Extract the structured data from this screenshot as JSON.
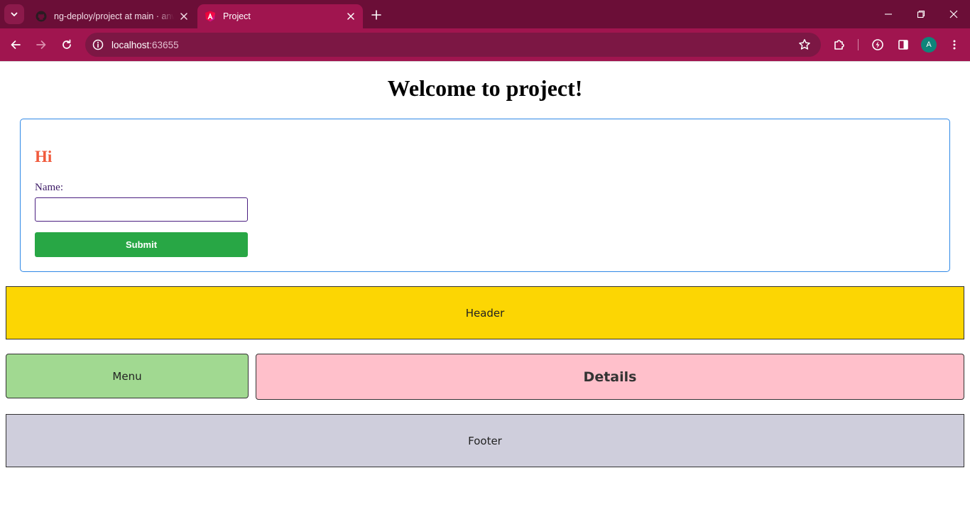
{
  "browser": {
    "tabs": [
      {
        "title": "ng-deploy/project at main · anw",
        "active": false,
        "icon": "github-icon"
      },
      {
        "title": "Project",
        "active": true,
        "icon": "angular-icon"
      }
    ],
    "address": {
      "host": "localhost",
      "port": ":63655"
    },
    "profile_initial": "A"
  },
  "page": {
    "title": "Welcome to project!",
    "form": {
      "greeting": "Hi",
      "name_label": "Name:",
      "name_value": "",
      "submit_label": "Submit"
    },
    "layout": {
      "header": "Header",
      "menu": "Menu",
      "details": "Details",
      "footer": "Footer"
    }
  },
  "colors": {
    "chrome_tabbar": "#6b0e37",
    "chrome_toolbar": "#a0154f",
    "greeting": "#f05a3c",
    "submit": "#28a745",
    "header": "#fcd603",
    "menu": "#a1d991",
    "details": "#ffc0cb",
    "footer": "#cfcedc"
  }
}
